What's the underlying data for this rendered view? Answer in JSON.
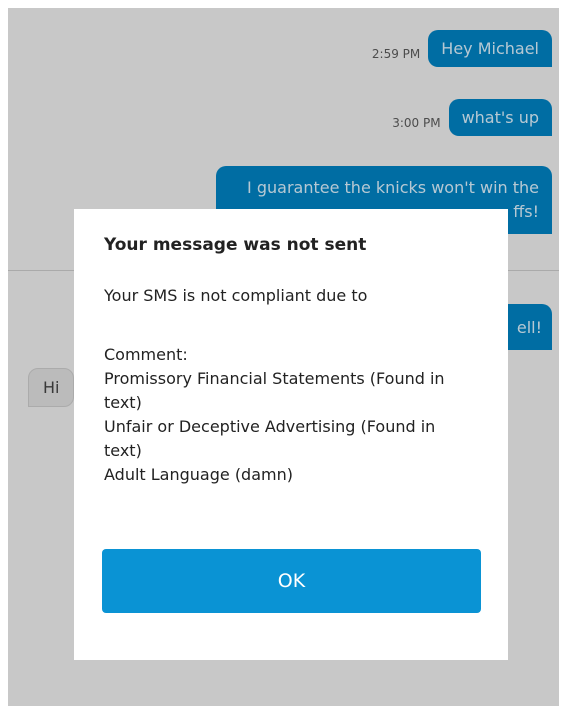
{
  "conversation": {
    "outgoing": [
      {
        "time": "2:59 PM",
        "text": "Hey Michael"
      },
      {
        "time": "3:00 PM",
        "text": "what's up"
      }
    ],
    "long_message_lines": [
      "I guarantee the knicks won't win the",
      "ffs!"
    ],
    "partial_outgoing": "ell!",
    "incoming_partial": "Hi"
  },
  "dialog": {
    "title": "Your message was not sent",
    "intro": "Your SMS is not compliant due to",
    "lines": [
      "Comment:",
      "Promissory Financial Statements (Found in",
      "text)",
      "Unfair or Deceptive Advertising (Found in",
      "text)",
      "Adult Language (damn)"
    ],
    "ok_label": "OK"
  },
  "colors": {
    "bubble_out": "#0080c0",
    "ok_button": "#0a93d4",
    "background": "#ececec"
  }
}
